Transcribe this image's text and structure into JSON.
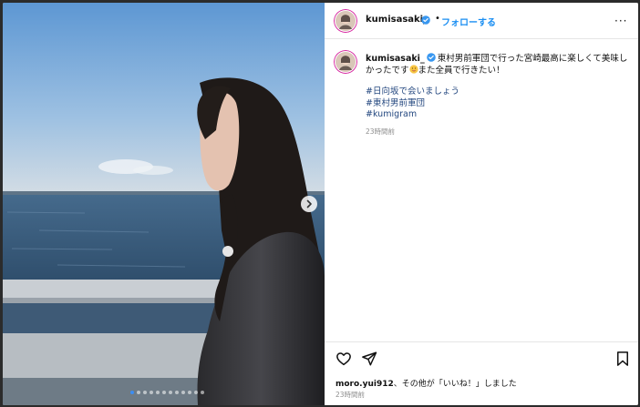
{
  "header": {
    "username": "kumisasaki_",
    "separator": "•",
    "follow_label": "フォローする",
    "more_label": "···"
  },
  "caption": {
    "username": "kumisasaki_",
    "text_before_emoji": "東村男前軍団で行った宮崎最高に楽しくて美味しかったです",
    "text_after_emoji": "また全員で行きたい！",
    "hashtags": [
      "#日向坂で会いましょう",
      "#東村男前軍団",
      "#kumigram"
    ],
    "time": "23時間前"
  },
  "likes": {
    "user": "moro.yui912",
    "suffix": "、その他が「いいね！」しました"
  },
  "post_time": "23時間前",
  "carousel": {
    "slide_count": 12,
    "active_index": 0
  },
  "icons": {
    "verified": "verified-badge-icon",
    "like": "heart-icon",
    "share": "paper-plane-icon",
    "save": "bookmark-icon",
    "next": "chevron-right-icon"
  },
  "colors": {
    "accent": "#1a8ef2",
    "hashtag": "#23477f",
    "muted": "#8e8e8e"
  }
}
